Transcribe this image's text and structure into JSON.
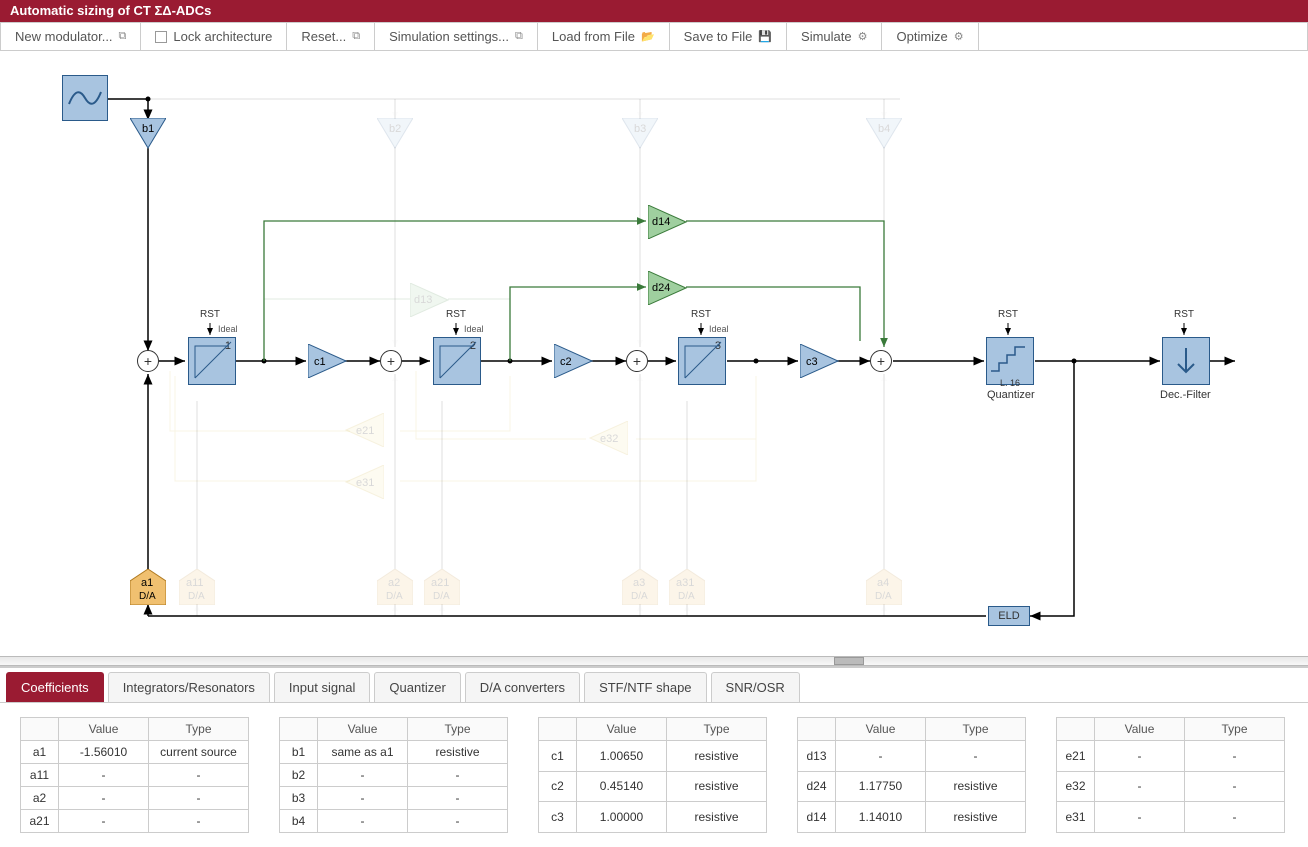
{
  "title": "Automatic sizing of CT ΣΔ-ADCs",
  "toolbar": {
    "new_modulator": "New modulator...",
    "lock_arch": "Lock architecture",
    "reset": "Reset...",
    "sim_settings": "Simulation settings...",
    "load": "Load from File",
    "save": "Save to File",
    "simulate": "Simulate",
    "optimize": "Optimize"
  },
  "diagram": {
    "rst": "RST",
    "ideal": "Ideal",
    "int1_idx": "1",
    "int2_idx": "2",
    "int3_idx": "3",
    "b1": "b1",
    "b2": "b2",
    "b3": "b3",
    "b4": "b4",
    "c1": "c1",
    "c2": "c2",
    "c3": "c3",
    "a1": "a1",
    "a11": "a11",
    "a2": "a2",
    "a21": "a21",
    "a3": "a3",
    "a31": "a31",
    "a4": "a4",
    "e21": "e21",
    "e31": "e31",
    "e32": "e32",
    "d13": "d13",
    "d14": "d14",
    "d24": "d24",
    "da": "D/A",
    "quantizer": "Quantizer",
    "quant_l": "L. 16",
    "decfilter": "Dec.-Filter",
    "eld": "ELD"
  },
  "tabs": {
    "coefficients": "Coefficients",
    "integrators": "Integrators/Resonators",
    "input": "Input signal",
    "quantizer": "Quantizer",
    "dac": "D/A converters",
    "stf": "STF/NTF shape",
    "snr": "SNR/OSR"
  },
  "headers": {
    "value": "Value",
    "type": "Type"
  },
  "tableA": [
    {
      "n": "a1",
      "v": "-1.56010",
      "t": "current source"
    },
    {
      "n": "a11",
      "v": "-",
      "t": "-"
    },
    {
      "n": "a2",
      "v": "-",
      "t": "-"
    },
    {
      "n": "a21",
      "v": "-",
      "t": "-"
    }
  ],
  "tableB": [
    {
      "n": "b1",
      "v": "same as a1",
      "t": "resistive"
    },
    {
      "n": "b2",
      "v": "-",
      "t": "-"
    },
    {
      "n": "b3",
      "v": "-",
      "t": "-"
    },
    {
      "n": "b4",
      "v": "-",
      "t": "-"
    }
  ],
  "tableC": [
    {
      "n": "c1",
      "v": "1.00650",
      "t": "resistive"
    },
    {
      "n": "c2",
      "v": "0.45140",
      "t": "resistive"
    },
    {
      "n": "c3",
      "v": "1.00000",
      "t": "resistive"
    }
  ],
  "tableD": [
    {
      "n": "d13",
      "v": "-",
      "t": "-"
    },
    {
      "n": "d24",
      "v": "1.17750",
      "t": "resistive"
    },
    {
      "n": "d14",
      "v": "1.14010",
      "t": "resistive"
    }
  ],
  "tableE": [
    {
      "n": "e21",
      "v": "-",
      "t": "-"
    },
    {
      "n": "e32",
      "v": "-",
      "t": "-"
    },
    {
      "n": "e31",
      "v": "-",
      "t": "-"
    }
  ]
}
